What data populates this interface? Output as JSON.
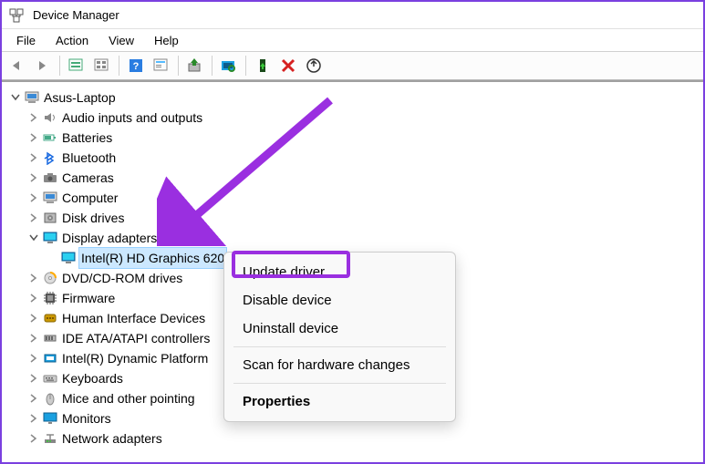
{
  "window": {
    "title": "Device Manager"
  },
  "menu": {
    "file": "File",
    "action": "Action",
    "view": "View",
    "help": "Help"
  },
  "toolbar_icons": {
    "back": "Back",
    "forward": "Forward",
    "up_container": "Show containers",
    "all_devices": "All devices",
    "help": "Help",
    "prop_sheet": "Properties sheet",
    "update": "Update driver",
    "scan": "Scan for hardware changes",
    "enable": "Enable device",
    "uninstall": "Uninstall device",
    "add_legacy": "Add legacy hardware"
  },
  "tree": {
    "root": "Asus-Laptop",
    "items": [
      {
        "label": "Audio inputs and outputs",
        "icon": "speaker"
      },
      {
        "label": "Batteries",
        "icon": "battery"
      },
      {
        "label": "Bluetooth",
        "icon": "bluetooth"
      },
      {
        "label": "Cameras",
        "icon": "camera"
      },
      {
        "label": "Computer",
        "icon": "computer"
      },
      {
        "label": "Disk drives",
        "icon": "disk"
      },
      {
        "label": "Display adapters",
        "icon": "display",
        "expanded": true,
        "children": [
          {
            "label": "Intel(R) HD Graphics 620",
            "icon": "display",
            "selected": true
          }
        ]
      },
      {
        "label": "DVD/CD-ROM drives",
        "icon": "dvd"
      },
      {
        "label": "Firmware",
        "icon": "firmware"
      },
      {
        "label": "Human Interface Devices",
        "icon": "hid"
      },
      {
        "label": "IDE ATA/ATAPI controllers",
        "icon": "ide"
      },
      {
        "label": "Intel(R) Dynamic Platform",
        "icon": "intel"
      },
      {
        "label": "Keyboards",
        "icon": "keyboard"
      },
      {
        "label": "Mice and other pointing",
        "icon": "mouse"
      },
      {
        "label": "Monitors",
        "icon": "monitor"
      },
      {
        "label": "Network adapters",
        "icon": "network"
      }
    ]
  },
  "context_menu": {
    "update": "Update driver",
    "disable": "Disable device",
    "uninstall": "Uninstall device",
    "scan": "Scan for hardware changes",
    "properties": "Properties"
  }
}
